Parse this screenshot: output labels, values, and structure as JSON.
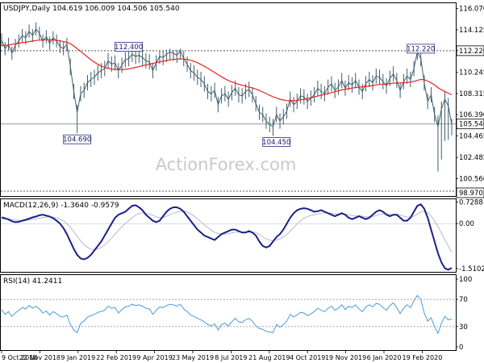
{
  "colors": {
    "background": "#ffffff",
    "frame": "#000000",
    "price": "#3f5d6d",
    "sma": "#e8231b",
    "macd": "#1b1f8a",
    "signal": "#b9b9c8",
    "rsi": "#4f9bd9",
    "level_line": "#555555",
    "label_box_fill": "#ffffff",
    "label_box_stroke": "#2b2b80",
    "watermark": "#c9c9c9"
  },
  "watermark": "ActionForex.com",
  "x_axis": {
    "labels": [
      "9 Oct 2018",
      "22 Nov 2018",
      "9 Jan 2019",
      "22 Feb 2019",
      "9 Apr 2019",
      "23 May 2019",
      "8 Jul 2019",
      "21 Aug 2019",
      "4 Oct 2019",
      "19 Nov 2019",
      "6 Jan 2020",
      "19 Feb 2020"
    ]
  },
  "chart_data": [
    {
      "type": "line",
      "panel": "price",
      "title": "USDJPY,Daily  104.619 106.009 104.506 105.540",
      "ylim": [
        98.97,
        116.55
      ],
      "y_ticks": [
        116.07,
        114.125,
        112.22,
        110.245,
        108.315,
        106.39,
        104.465,
        102.485,
        100.56,
        98.97
      ],
      "current_price": 105.54,
      "horizontal_levels": [
        112.22,
        105.54
      ],
      "annotations": [
        {
          "text": "112.400",
          "x_label": "Mar 2019",
          "value": 112.4
        },
        {
          "text": "104.690",
          "x_label": "Jan 2019",
          "value": 104.69
        },
        {
          "text": "104.450",
          "x_label": "Aug 2019",
          "value": 104.45
        },
        {
          "text": "112.220",
          "x_label": "Feb 2020",
          "value": 112.22
        }
      ],
      "series": [
        {
          "role": "close",
          "values": [
            113.2,
            112.4,
            112.8,
            112.0,
            112.7,
            113.1,
            113.6,
            113.4,
            114.0,
            113.6,
            114.2,
            113.8,
            113.1,
            113.5,
            112.9,
            113.4,
            113.1,
            112.6,
            112.4,
            112.8,
            110.8,
            108.5,
            106.6,
            108.3,
            108.6,
            109.3,
            109.6,
            109.8,
            110.2,
            110.4,
            110.6,
            111.3,
            111.0,
            111.1,
            110.4,
            110.9,
            111.4,
            111.5,
            111.9,
            111.7,
            111.8,
            111.6,
            111.3,
            111.2,
            110.4,
            111.1,
            111.7,
            111.6,
            111.9,
            112.1,
            112.0,
            111.8,
            112.2,
            111.5,
            111.0,
            110.4,
            110.2,
            109.8,
            109.6,
            109.2,
            108.5,
            108.3,
            108.6,
            107.3,
            108.1,
            108.3,
            107.8,
            108.4,
            108.8,
            108.2,
            108.1,
            108.5,
            108.7,
            108.2,
            107.4,
            106.6,
            106.4,
            105.8,
            105.5,
            105.3,
            106.4,
            105.8,
            106.2,
            106.7,
            107.8,
            107.3,
            107.6,
            108.1,
            108.0,
            107.6,
            107.9,
            108.2,
            108.8,
            108.5,
            108.3,
            108.9,
            109.2,
            108.6,
            108.9,
            109.5,
            108.8,
            109.3,
            109.1,
            109.5,
            108.9,
            108.5,
            109.2,
            109.6,
            109.3,
            109.9,
            109.8,
            109.4,
            109.0,
            109.7,
            110.1,
            109.5,
            108.6,
            109.4,
            109.9,
            109.6,
            110.6,
            112.1,
            111.5,
            109.3,
            107.6,
            108.2,
            106.4,
            105.3,
            106.9,
            107.8,
            107.2,
            105.5
          ],
          "lows": [
            112.6,
            111.8,
            112.2,
            111.4,
            112.1,
            112.5,
            113.0,
            112.8,
            113.4,
            113.0,
            113.6,
            113.2,
            112.5,
            112.9,
            112.3,
            112.8,
            112.5,
            112.0,
            111.8,
            112.2,
            110.0,
            107.8,
            104.69,
            107.6,
            107.9,
            108.6,
            108.9,
            109.1,
            109.5,
            109.7,
            109.9,
            110.6,
            110.3,
            110.4,
            109.7,
            110.2,
            110.7,
            110.8,
            111.2,
            111.0,
            111.1,
            110.9,
            110.6,
            110.5,
            109.7,
            110.4,
            111.0,
            110.9,
            111.2,
            111.4,
            111.3,
            111.1,
            111.5,
            110.8,
            110.3,
            109.7,
            109.5,
            109.1,
            108.9,
            108.5,
            107.8,
            107.6,
            107.9,
            106.6,
            107.4,
            107.6,
            107.1,
            107.7,
            108.1,
            107.5,
            107.4,
            107.8,
            108.0,
            107.5,
            106.7,
            105.9,
            105.7,
            105.1,
            104.8,
            104.45,
            105.7,
            105.1,
            105.5,
            106.0,
            107.1,
            106.6,
            106.9,
            107.4,
            107.3,
            106.9,
            107.2,
            107.5,
            108.1,
            107.8,
            107.6,
            108.2,
            108.5,
            107.9,
            108.2,
            108.8,
            108.1,
            108.6,
            108.4,
            108.8,
            108.2,
            107.8,
            108.5,
            108.9,
            108.6,
            109.2,
            109.1,
            108.7,
            108.3,
            109.0,
            109.4,
            108.8,
            107.9,
            108.7,
            109.2,
            108.9,
            109.9,
            111.4,
            110.8,
            108.6,
            106.9,
            107.5,
            105.7,
            101.2,
            102.3,
            104.0,
            104.1,
            104.5
          ],
          "highs": [
            113.8,
            113.0,
            113.4,
            112.6,
            113.3,
            113.7,
            114.2,
            114.0,
            114.6,
            114.2,
            114.8,
            114.4,
            113.7,
            114.1,
            113.5,
            114.0,
            113.7,
            113.2,
            113.0,
            113.4,
            111.5,
            109.2,
            107.3,
            109.0,
            109.3,
            110.0,
            110.3,
            110.5,
            110.9,
            111.1,
            111.3,
            112.0,
            111.7,
            111.8,
            111.1,
            111.6,
            112.1,
            112.2,
            112.4,
            112.3,
            112.3,
            112.2,
            112.0,
            111.9,
            111.1,
            111.8,
            112.2,
            112.2,
            112.3,
            112.4,
            112.3,
            112.3,
            112.4,
            112.2,
            111.7,
            111.1,
            110.9,
            110.5,
            110.3,
            109.9,
            109.2,
            109.0,
            109.3,
            108.0,
            108.8,
            109.0,
            108.5,
            109.1,
            109.5,
            108.9,
            108.8,
            109.2,
            109.4,
            108.9,
            108.1,
            107.3,
            107.1,
            106.5,
            106.2,
            106.0,
            107.1,
            106.5,
            106.9,
            107.4,
            108.5,
            108.0,
            108.3,
            108.8,
            108.7,
            108.3,
            108.6,
            108.9,
            109.5,
            109.2,
            109.0,
            109.6,
            109.9,
            109.3,
            109.6,
            110.2,
            109.5,
            110.0,
            109.8,
            110.2,
            109.6,
            109.2,
            109.9,
            110.3,
            110.0,
            110.6,
            110.5,
            110.1,
            109.7,
            110.4,
            110.8,
            110.2,
            109.3,
            110.1,
            110.6,
            110.3,
            111.3,
            112.22,
            112.2,
            110.0,
            108.3,
            108.9,
            107.1,
            106.3,
            107.6,
            108.5,
            107.9,
            106.0
          ]
        },
        {
          "role": "moving_average",
          "values": [
            112.7,
            112.7,
            112.75,
            112.8,
            112.85,
            112.9,
            112.95,
            113.0,
            113.05,
            113.1,
            113.15,
            113.18,
            113.2,
            113.22,
            113.22,
            113.2,
            113.17,
            113.12,
            113.05,
            112.98,
            112.85,
            112.65,
            112.4,
            112.15,
            111.9,
            111.65,
            111.4,
            111.18,
            110.98,
            110.82,
            110.7,
            110.6,
            110.55,
            110.52,
            110.5,
            110.5,
            110.52,
            110.57,
            110.63,
            110.7,
            110.77,
            110.85,
            110.93,
            111.0,
            111.07,
            111.13,
            111.2,
            111.27,
            111.33,
            111.38,
            111.42,
            111.45,
            111.47,
            111.46,
            111.42,
            111.35,
            111.25,
            111.12,
            110.97,
            110.8,
            110.62,
            110.43,
            110.23,
            110.03,
            109.84,
            109.66,
            109.5,
            109.37,
            109.26,
            109.16,
            109.07,
            108.99,
            108.91,
            108.82,
            108.72,
            108.6,
            108.46,
            108.31,
            108.16,
            108.02,
            107.9,
            107.8,
            107.72,
            107.67,
            107.65,
            107.66,
            107.69,
            107.74,
            107.8,
            107.86,
            107.93,
            108.0,
            108.08,
            108.16,
            108.24,
            108.32,
            108.4,
            108.48,
            108.56,
            108.64,
            108.7,
            108.76,
            108.81,
            108.86,
            108.9,
            108.93,
            108.97,
            109.01,
            109.05,
            109.1,
            109.14,
            109.17,
            109.19,
            109.22,
            109.26,
            109.28,
            109.28,
            109.3,
            109.33,
            109.36,
            109.42,
            109.52,
            109.6,
            109.58,
            109.45,
            109.3,
            109.1,
            108.85,
            108.65,
            108.5,
            108.35,
            108.2
          ]
        }
      ]
    },
    {
      "type": "line",
      "panel": "macd",
      "title": "MACD(12,26,9) -1.3640 -0.9579",
      "ylim": [
        -1.62,
        0.82
      ],
      "y_ticks": [
        0.7288,
        0.0,
        -1.5102
      ],
      "series": [
        {
          "role": "macd",
          "values": [
            0.21,
            0.18,
            0.14,
            0.08,
            0.05,
            0.06,
            0.1,
            0.13,
            0.17,
            0.21,
            0.24,
            0.28,
            0.3,
            0.27,
            0.24,
            0.18,
            0.1,
            0.0,
            -0.15,
            -0.35,
            -0.6,
            -0.85,
            -1.05,
            -1.17,
            -1.2,
            -1.15,
            -1.05,
            -0.9,
            -0.75,
            -0.6,
            -0.4,
            -0.2,
            0.0,
            0.2,
            0.3,
            0.35,
            0.4,
            0.5,
            0.6,
            0.62,
            0.55,
            0.45,
            0.3,
            0.2,
            0.1,
            0.05,
            0.1,
            0.25,
            0.4,
            0.5,
            0.55,
            0.55,
            0.5,
            0.4,
            0.25,
            0.1,
            -0.05,
            -0.2,
            -0.3,
            -0.4,
            -0.45,
            -0.5,
            -0.55,
            -0.45,
            -0.35,
            -0.3,
            -0.25,
            -0.2,
            -0.2,
            -0.25,
            -0.3,
            -0.3,
            -0.25,
            -0.3,
            -0.4,
            -0.6,
            -0.75,
            -0.8,
            -0.75,
            -0.6,
            -0.45,
            -0.35,
            -0.2,
            0.0,
            0.2,
            0.35,
            0.45,
            0.5,
            0.52,
            0.5,
            0.45,
            0.4,
            0.42,
            0.45,
            0.4,
            0.35,
            0.3,
            0.25,
            0.3,
            0.35,
            0.3,
            0.2,
            0.15,
            0.2,
            0.25,
            0.2,
            0.15,
            0.2,
            0.3,
            0.4,
            0.45,
            0.4,
            0.3,
            0.25,
            0.3,
            0.3,
            0.2,
            0.1,
            0.1,
            0.2,
            0.4,
            0.6,
            0.65,
            0.5,
            0.2,
            -0.2,
            -0.6,
            -1.0,
            -1.3,
            -1.5,
            -1.55,
            -1.49
          ]
        },
        {
          "role": "signal",
          "values": [
            0.15,
            0.16,
            0.16,
            0.14,
            0.12,
            0.11,
            0.11,
            0.11,
            0.12,
            0.14,
            0.16,
            0.18,
            0.21,
            0.22,
            0.23,
            0.22,
            0.19,
            0.15,
            0.09,
            0.0,
            -0.12,
            -0.27,
            -0.43,
            -0.58,
            -0.71,
            -0.8,
            -0.86,
            -0.87,
            -0.85,
            -0.8,
            -0.72,
            -0.61,
            -0.49,
            -0.35,
            -0.22,
            -0.1,
            0.0,
            0.1,
            0.2,
            0.29,
            0.34,
            0.36,
            0.35,
            0.32,
            0.28,
            0.23,
            0.2,
            0.21,
            0.25,
            0.3,
            0.35,
            0.39,
            0.42,
            0.42,
            0.39,
            0.33,
            0.26,
            0.16,
            0.06,
            -0.04,
            -0.13,
            -0.22,
            -0.29,
            -0.33,
            -0.35,
            -0.35,
            -0.33,
            -0.31,
            -0.29,
            -0.28,
            -0.28,
            -0.28,
            -0.28,
            -0.28,
            -0.3,
            -0.36,
            -0.44,
            -0.51,
            -0.56,
            -0.57,
            -0.55,
            -0.51,
            -0.45,
            -0.36,
            -0.25,
            -0.13,
            -0.01,
            0.09,
            0.18,
            0.24,
            0.28,
            0.3,
            0.33,
            0.35,
            0.36,
            0.36,
            0.35,
            0.33,
            0.32,
            0.33,
            0.32,
            0.3,
            0.27,
            0.26,
            0.26,
            0.25,
            0.23,
            0.23,
            0.24,
            0.27,
            0.31,
            0.33,
            0.33,
            0.31,
            0.31,
            0.31,
            0.29,
            0.25,
            0.22,
            0.22,
            0.25,
            0.32,
            0.39,
            0.41,
            0.37,
            0.26,
            0.1,
            -0.1,
            -0.32,
            -0.55,
            -0.75,
            -0.96
          ]
        }
      ]
    },
    {
      "type": "line",
      "panel": "rsi",
      "title": "RSI(14) 41.2411",
      "ylim": [
        0,
        100
      ],
      "y_ticks": [
        100,
        70,
        30,
        0
      ],
      "levels": [
        70,
        30
      ],
      "series": [
        {
          "role": "rsi",
          "values": [
            55,
            48,
            52,
            45,
            50,
            54,
            58,
            56,
            61,
            57,
            60,
            56,
            50,
            53,
            47,
            52,
            49,
            45,
            44,
            47,
            33,
            25,
            21,
            35,
            38,
            44,
            46,
            48,
            51,
            52,
            54,
            60,
            57,
            58,
            50,
            55,
            59,
            60,
            63,
            61,
            62,
            60,
            57,
            56,
            48,
            54,
            59,
            58,
            61,
            63,
            62,
            60,
            63,
            56,
            52,
            47,
            45,
            42,
            40,
            37,
            33,
            31,
            34,
            25,
            33,
            35,
            31,
            37,
            42,
            37,
            36,
            40,
            42,
            38,
            31,
            27,
            26,
            23,
            22,
            21,
            33,
            29,
            33,
            38,
            48,
            44,
            47,
            51,
            50,
            46,
            49,
            52,
            57,
            54,
            52,
            57,
            60,
            54,
            57,
            62,
            55,
            60,
            58,
            62,
            56,
            52,
            59,
            62,
            59,
            64,
            63,
            58,
            54,
            61,
            65,
            58,
            49,
            57,
            62,
            58,
            68,
            76,
            70,
            50,
            38,
            43,
            30,
            20,
            35,
            45,
            40,
            41
          ]
        }
      ]
    }
  ]
}
